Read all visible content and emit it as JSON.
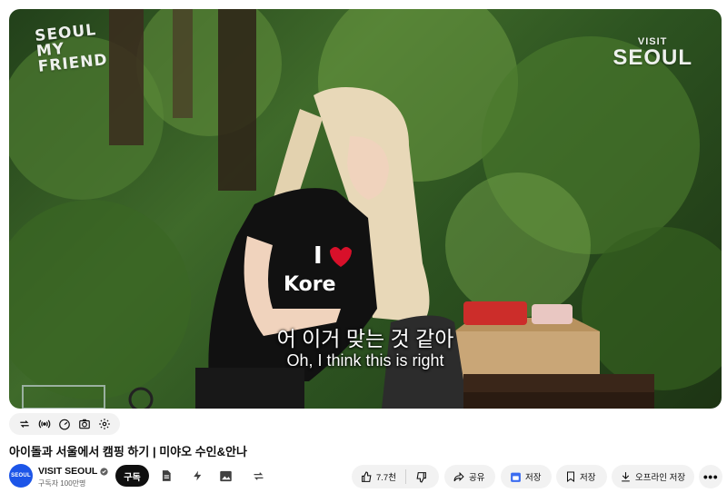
{
  "video": {
    "watermark_left": [
      "SEOUL",
      "MY",
      "FRIEND"
    ],
    "watermark_right_small": "VISIT",
    "watermark_right_big": "SEOUL",
    "subtitle_korean": "어 이거 맞는 것 같아",
    "subtitle_english": "Oh, I think this is right"
  },
  "controls": {
    "icons": [
      "loop-icon",
      "broadcast-icon",
      "speed-gauge-icon",
      "screenshot-camera-icon",
      "settings-gear-icon"
    ]
  },
  "title": "아이돌과 서울에서 캠핑 하기 | 미야오 수인&안나",
  "channel": {
    "avatar_text": "SEOUL",
    "name": "VISIT SEOUL",
    "subscribers": "구독자 100만명",
    "subscribe_label": "구독"
  },
  "actions": {
    "like_count": "7.7천",
    "share_label": "공유",
    "save_label_1": "저장",
    "save_label_2": "저장",
    "offline_label": "오프라인 저장",
    "more_label": "•••"
  },
  "colors": {
    "subscribe_bg": "#0f0f0f",
    "pill_bg": "#f2f2f2",
    "avatar_bg": "#1c55e8",
    "save_icon_blue": "#3b6cf0"
  }
}
